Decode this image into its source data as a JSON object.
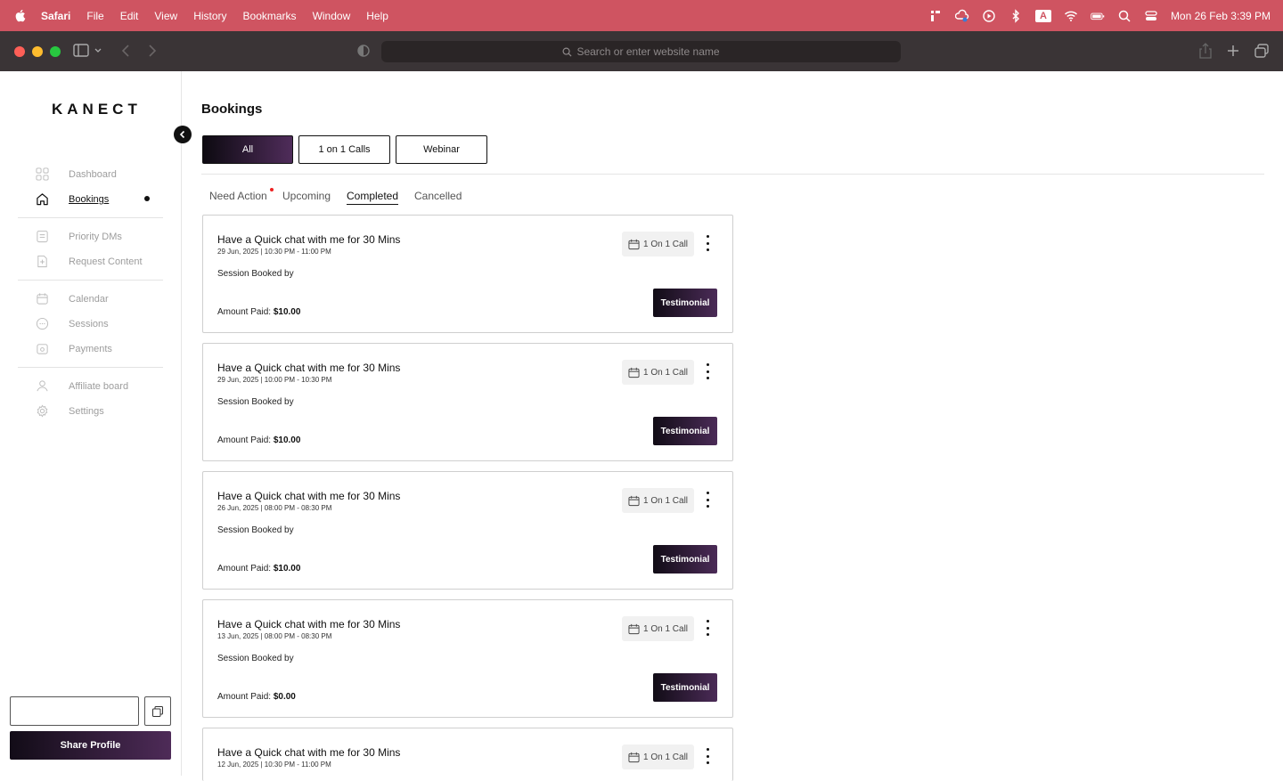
{
  "menubar": {
    "app": "Safari",
    "items": [
      "File",
      "Edit",
      "View",
      "History",
      "Bookmarks",
      "Window",
      "Help"
    ],
    "input_badge": "A",
    "datetime": "Mon 26 Feb  3:39 PM"
  },
  "browser": {
    "address_placeholder": "Search or enter website name"
  },
  "sidebar": {
    "logo": "KANECT",
    "items": [
      {
        "label": "Dashboard",
        "icon": "grid-icon"
      },
      {
        "label": "Bookings",
        "icon": "home-icon",
        "active": true
      },
      {
        "label": "Priority DMs",
        "icon": "document-icon"
      },
      {
        "label": "Request Content",
        "icon": "file-plus-icon"
      },
      {
        "label": "Calendar",
        "icon": "calendar-icon"
      },
      {
        "label": "Sessions",
        "icon": "chat-icon"
      },
      {
        "label": "Payments",
        "icon": "wallet-icon"
      },
      {
        "label": "Affiliate board",
        "icon": "user-icon"
      },
      {
        "label": "Settings",
        "icon": "gear-icon"
      }
    ],
    "share_button": "Share Profile"
  },
  "main": {
    "title": "Bookings",
    "type_tabs": [
      "All",
      "1 on 1 Calls",
      "Webinar"
    ],
    "status_tabs": [
      "Need Action",
      "Upcoming",
      "Completed",
      "Cancelled"
    ],
    "cards": [
      {
        "title": "Have a Quick chat with me for 30 Mins",
        "date": "29 Jun, 2025 | 10:30 PM - 11:00 PM",
        "booked": "Session Booked by",
        "amount_label": "Amount Paid:",
        "amount": "$10.00",
        "badge": "1 On 1 Call",
        "button": "Testimonial"
      },
      {
        "title": "Have a Quick chat with me for 30 Mins",
        "date": "29 Jun, 2025 | 10:00 PM - 10:30 PM",
        "booked": "Session Booked by",
        "amount_label": "Amount Paid:",
        "amount": "$10.00",
        "badge": "1 On 1 Call",
        "button": "Testimonial"
      },
      {
        "title": "Have a Quick chat with me for 30 Mins",
        "date": "26 Jun, 2025 | 08:00 PM - 08:30 PM",
        "booked": "Session Booked by",
        "amount_label": "Amount Paid:",
        "amount": "$10.00",
        "badge": "1 On 1 Call",
        "button": "Testimonial"
      },
      {
        "title": "Have a Quick chat with me for 30 Mins",
        "date": "13 Jun, 2025 | 08:00 PM - 08:30 PM",
        "booked": "Session Booked by",
        "amount_label": "Amount Paid:",
        "amount": "$0.00",
        "badge": "1 On 1 Call",
        "button": "Testimonial"
      },
      {
        "title": "Have a Quick chat with me for 30 Mins",
        "date": "12 Jun, 2025 | 10:30 PM - 11:00 PM",
        "badge": "1 On 1 Call"
      }
    ]
  }
}
